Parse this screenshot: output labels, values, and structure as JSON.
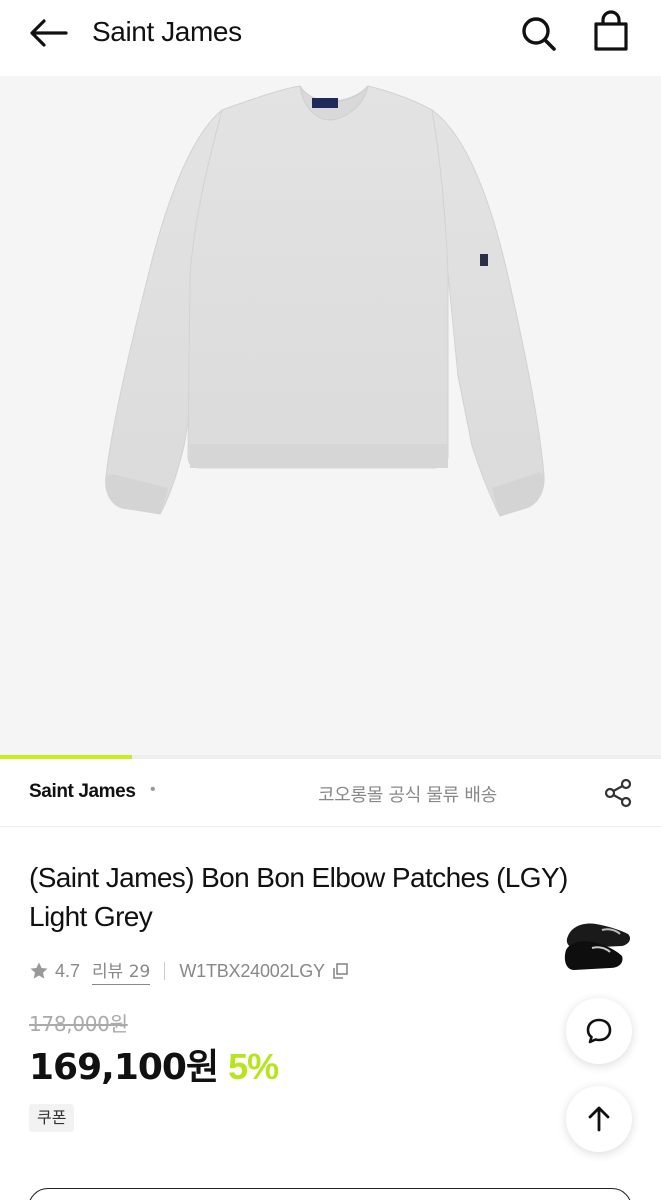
{
  "header": {
    "title": "Saint James",
    "back_icon": "arrow-left-icon",
    "search_icon": "search-icon",
    "bag_icon": "shopping-bag-icon"
  },
  "gallery": {
    "image_alt": "light grey sweatshirt product image",
    "progress": 0.2,
    "accent_color": "#c6f01c"
  },
  "brand_bar": {
    "brand": "Saint James",
    "dot": "•",
    "shipping": "코오롱몰 공식 물류 배송",
    "share_icon": "share-icon"
  },
  "product": {
    "title": "(Saint James) Bon Bon Elbow Patches (LGY) Light Grey",
    "rating": "4.7",
    "review_label": "리뷰 29",
    "sku": "W1TBX24002LGY",
    "original_price": "178,000원",
    "sale_price": "169,100원",
    "discount": "5%",
    "coupon": "쿠폰"
  },
  "floating": {
    "chat_icon": "chat-bubble-icon",
    "top_icon": "arrow-up-icon"
  }
}
